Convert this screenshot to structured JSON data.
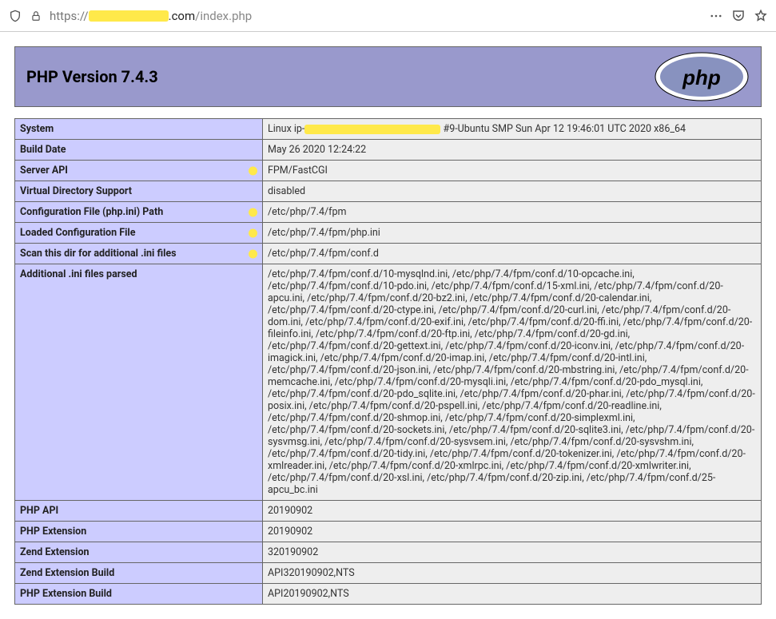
{
  "url": {
    "protocol": "https://",
    "host_suffix": ".com",
    "path": "/index.php"
  },
  "header": {
    "title": "PHP Version 7.4.3"
  },
  "rows": [
    {
      "k": "System",
      "v_pre": "Linux ip-",
      "redact": true,
      "v_post": " #9-Ubuntu SMP Sun Apr 12 19:46:01 UTC 2020 x86_64",
      "dot": false
    },
    {
      "k": "Build Date",
      "v": "May 26 2020 12:24:22",
      "dot": false
    },
    {
      "k": "Server API",
      "v": "FPM/FastCGI",
      "dot": true
    },
    {
      "k": "Virtual Directory Support",
      "v": "disabled",
      "dot": false
    },
    {
      "k": "Configuration File (php.ini) Path",
      "v": "/etc/php/7.4/fpm",
      "dot": true
    },
    {
      "k": "Loaded Configuration File",
      "v": "/etc/php/7.4/fpm/php.ini",
      "dot": true
    },
    {
      "k": "Scan this dir for additional .ini files",
      "v": "/etc/php/7.4/fpm/conf.d",
      "dot": true
    },
    {
      "k": "Additional .ini files parsed",
      "v": "/etc/php/7.4/fpm/conf.d/10-mysqlnd.ini, /etc/php/7.4/fpm/conf.d/10-opcache.ini, /etc/php/7.4/fpm/conf.d/10-pdo.ini, /etc/php/7.4/fpm/conf.d/15-xml.ini, /etc/php/7.4/fpm/conf.d/20-apcu.ini, /etc/php/7.4/fpm/conf.d/20-bz2.ini, /etc/php/7.4/fpm/conf.d/20-calendar.ini, /etc/php/7.4/fpm/conf.d/20-ctype.ini, /etc/php/7.4/fpm/conf.d/20-curl.ini, /etc/php/7.4/fpm/conf.d/20-dom.ini, /etc/php/7.4/fpm/conf.d/20-exif.ini, /etc/php/7.4/fpm/conf.d/20-ffi.ini, /etc/php/7.4/fpm/conf.d/20-fileinfo.ini, /etc/php/7.4/fpm/conf.d/20-ftp.ini, /etc/php/7.4/fpm/conf.d/20-gd.ini, /etc/php/7.4/fpm/conf.d/20-gettext.ini, /etc/php/7.4/fpm/conf.d/20-iconv.ini, /etc/php/7.4/fpm/conf.d/20-imagick.ini, /etc/php/7.4/fpm/conf.d/20-imap.ini, /etc/php/7.4/fpm/conf.d/20-intl.ini, /etc/php/7.4/fpm/conf.d/20-json.ini, /etc/php/7.4/fpm/conf.d/20-mbstring.ini, /etc/php/7.4/fpm/conf.d/20-memcache.ini, /etc/php/7.4/fpm/conf.d/20-mysqli.ini, /etc/php/7.4/fpm/conf.d/20-pdo_mysql.ini, /etc/php/7.4/fpm/conf.d/20-pdo_sqlite.ini, /etc/php/7.4/fpm/conf.d/20-phar.ini, /etc/php/7.4/fpm/conf.d/20-posix.ini, /etc/php/7.4/fpm/conf.d/20-pspell.ini, /etc/php/7.4/fpm/conf.d/20-readline.ini, /etc/php/7.4/fpm/conf.d/20-shmop.ini, /etc/php/7.4/fpm/conf.d/20-simplexml.ini, /etc/php/7.4/fpm/conf.d/20-sockets.ini, /etc/php/7.4/fpm/conf.d/20-sqlite3.ini, /etc/php/7.4/fpm/conf.d/20-sysvmsg.ini, /etc/php/7.4/fpm/conf.d/20-sysvsem.ini, /etc/php/7.4/fpm/conf.d/20-sysvshm.ini, /etc/php/7.4/fpm/conf.d/20-tidy.ini, /etc/php/7.4/fpm/conf.d/20-tokenizer.ini, /etc/php/7.4/fpm/conf.d/20-xmlreader.ini, /etc/php/7.4/fpm/conf.d/20-xmlrpc.ini, /etc/php/7.4/fpm/conf.d/20-xmlwriter.ini, /etc/php/7.4/fpm/conf.d/20-xsl.ini, /etc/php/7.4/fpm/conf.d/20-zip.ini, /etc/php/7.4/fpm/conf.d/25-apcu_bc.ini",
      "dot": false
    },
    {
      "k": "PHP API",
      "v": "20190902",
      "dot": false
    },
    {
      "k": "PHP Extension",
      "v": "20190902",
      "dot": false
    },
    {
      "k": "Zend Extension",
      "v": "320190902",
      "dot": false
    },
    {
      "k": "Zend Extension Build",
      "v": "API320190902,NTS",
      "dot": false
    },
    {
      "k": "PHP Extension Build",
      "v": "API20190902,NTS",
      "dot": false
    }
  ]
}
